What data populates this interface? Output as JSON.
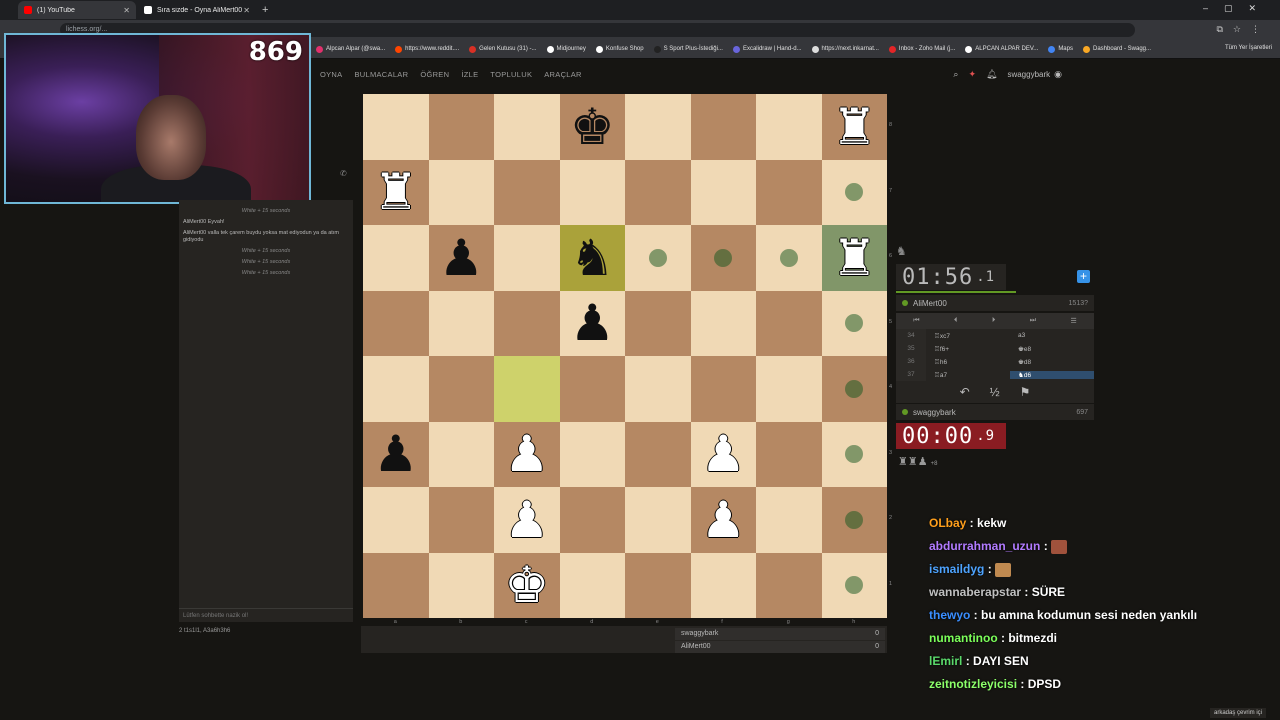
{
  "browser": {
    "tabs": [
      {
        "label": "(1) YouTube",
        "active": true,
        "color": "#ff0000"
      },
      {
        "label": "Sıra sizde - Oyna AliMert00",
        "active": false,
        "color": "#ffffff"
      }
    ],
    "url": "lichess.org/...",
    "bookmarks": [
      {
        "label": "Alpcan Alpar (@swa...",
        "color": "#e1306c"
      },
      {
        "label": "https://www.reddit....",
        "color": "#ff4500"
      },
      {
        "label": "Gelen Kutusu (31) -...",
        "color": "#d93025"
      },
      {
        "label": "Midjourney",
        "color": "#ffffff"
      },
      {
        "label": "Konfuse Shop",
        "color": "#ffffff"
      },
      {
        "label": "S Sport Plus-İstediği...",
        "color": "#222222"
      },
      {
        "label": "Excalidraw | Hand-d...",
        "color": "#6965db"
      },
      {
        "label": "https://next.inkarnat...",
        "color": "#dddddd"
      },
      {
        "label": "Inbox - Zoho Mail (j...",
        "color": "#e42527"
      },
      {
        "label": "ALPCAN ALPAR DEV...",
        "color": "#ffffff"
      },
      {
        "label": "Maps",
        "color": "#4285f4"
      },
      {
        "label": "Dashboard - Swagg...",
        "color": "#f9a825"
      }
    ],
    "all_bookmarks": "Tüm Yer İşaretleri"
  },
  "webcam": {
    "count": "869"
  },
  "nav": {
    "items": [
      "OYNA",
      "BULMACALAR",
      "ÖĞREN",
      "İZLE",
      "TOPLULUK",
      "ARAÇLAR"
    ],
    "username": "swaggybark"
  },
  "chat": {
    "lines": [
      {
        "text": "White + 15 seconds",
        "sys": true
      },
      {
        "text": "AliMert00  Eyvah!",
        "sys": false
      },
      {
        "text": "AliMert00  valla tek çarem buydu yoksa mat ediyodun ya da atım gidiyodu",
        "sys": false
      },
      {
        "text": "White + 15 seconds",
        "sys": true
      },
      {
        "text": "White + 15 seconds",
        "sys": true
      },
      {
        "text": "White + 15 seconds",
        "sys": true
      }
    ],
    "placeholder": "Lütfen sohbette nazik ol!",
    "spectators": "2  t1s1l1, A3a6h3h6"
  },
  "board": {
    "files": [
      "a",
      "b",
      "c",
      "d",
      "e",
      "f",
      "g",
      "h"
    ],
    "ranks": [
      "8",
      "7",
      "6",
      "5",
      "4",
      "3",
      "2",
      "1"
    ],
    "pieces": [
      {
        "sq": "d8",
        "glyph": "♚",
        "color": "b"
      },
      {
        "sq": "h8",
        "glyph": "♜",
        "color": "w"
      },
      {
        "sq": "a7",
        "glyph": "♜",
        "color": "w"
      },
      {
        "sq": "b6",
        "glyph": "♟",
        "color": "b"
      },
      {
        "sq": "d6",
        "glyph": "♞",
        "color": "b"
      },
      {
        "sq": "h6",
        "glyph": "♜",
        "color": "w"
      },
      {
        "sq": "d5",
        "glyph": "♟",
        "color": "b"
      },
      {
        "sq": "a3",
        "glyph": "♟",
        "color": "b"
      },
      {
        "sq": "c3",
        "glyph": "♟",
        "color": "w"
      },
      {
        "sq": "f3",
        "glyph": "♟",
        "color": "w"
      },
      {
        "sq": "c2",
        "glyph": "♟",
        "color": "w"
      },
      {
        "sq": "f2",
        "glyph": "♟",
        "color": "w"
      },
      {
        "sq": "c1",
        "glyph": "♚",
        "color": "w"
      }
    ],
    "lastmove": [
      "c4",
      "d6"
    ],
    "selected": "h6",
    "dests": [
      "h7",
      "e6",
      "f6",
      "g6",
      "h5",
      "h4",
      "h3",
      "h2",
      "h1"
    ]
  },
  "underboard": {
    "rows": [
      {
        "name": "swaggybark",
        "score": "0"
      },
      {
        "name": "AliMert00",
        "score": "0"
      }
    ]
  },
  "game": {
    "opponent": {
      "name": "AliMert00",
      "rating": "1513?",
      "clock_main": "01:56",
      "clock_tenth": ".1"
    },
    "me": {
      "name": "swaggybark",
      "rating": "697",
      "clock_main": "00:00",
      "clock_tenth": ".9"
    },
    "moves": [
      {
        "n": "34",
        "w": "♖xc7",
        "b": "a3"
      },
      {
        "n": "35",
        "w": "♖f6+",
        "b": "♚e8"
      },
      {
        "n": "36",
        "w": "♖h6",
        "b": "♚d8"
      },
      {
        "n": "37",
        "w": "♖a7",
        "b": "♞d6"
      }
    ],
    "material": "+8",
    "captured": "♜♜♟"
  },
  "twitch": {
    "messages": [
      {
        "user": "OLbay",
        "color": "#ff9f1c",
        "text": "kekw",
        "emote": null
      },
      {
        "user": "abdurrahman_uzun",
        "color": "#b27bff",
        "text": "",
        "emote": "#a0523c"
      },
      {
        "user": "ismaildyg",
        "color": "#4ea4ff",
        "text": "",
        "emote": "#c08a50"
      },
      {
        "user": "wannaberapstar",
        "color": "#c0c0c0",
        "text": "SÜRE",
        "emote": null
      },
      {
        "user": "thewyo",
        "color": "#3a8eff",
        "text": "bu amına kodumun sesi neden yankılı",
        "emote": null
      },
      {
        "user": "numantinoo",
        "color": "#7cff5a",
        "text": "bitmezdi",
        "emote": null
      },
      {
        "user": "lEmirl",
        "color": "#5ad86a",
        "text": "DAYI SEN",
        "emote": null
      },
      {
        "user": "zeitnotizleyicisi",
        "color": "#8cff6a",
        "text": "DPSD",
        "emote": null
      }
    ]
  },
  "friends": "arkadaş çevrim içi"
}
